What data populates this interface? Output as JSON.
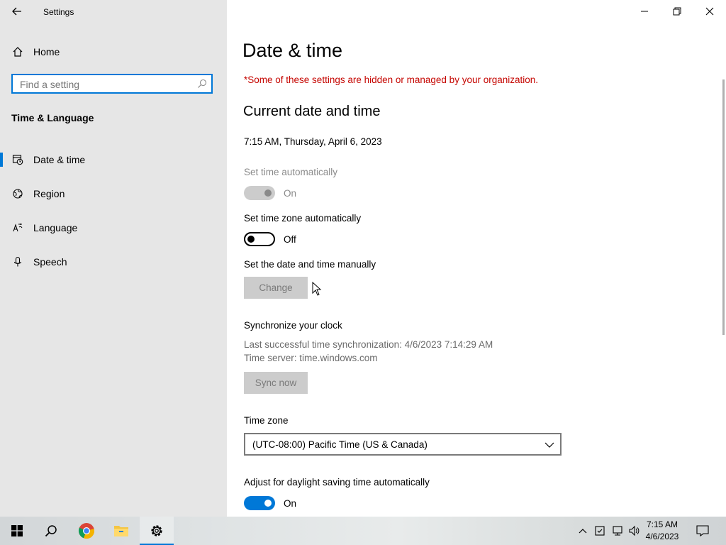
{
  "window": {
    "title": "Settings"
  },
  "sidebar": {
    "home_label": "Home",
    "search_placeholder": "Find a setting",
    "section": "Time & Language",
    "items": [
      {
        "label": "Date & time",
        "icon": "date-time-icon",
        "selected": true
      },
      {
        "label": "Region",
        "icon": "globe-icon",
        "selected": false
      },
      {
        "label": "Language",
        "icon": "language-icon",
        "selected": false
      },
      {
        "label": "Speech",
        "icon": "microphone-icon",
        "selected": false
      }
    ]
  },
  "main": {
    "title": "Date & time",
    "managed_notice": "*Some of these settings are hidden or managed by your organization.",
    "current_heading": "Current date and time",
    "current_value": "7:15 AM, Thursday, April 6, 2023",
    "set_time_auto": {
      "label": "Set time automatically",
      "state": "On",
      "on": true,
      "disabled": true
    },
    "set_tz_auto": {
      "label": "Set time zone automatically",
      "state": "Off",
      "on": false
    },
    "manual": {
      "label": "Set the date and time manually",
      "button": "Change"
    },
    "sync": {
      "heading": "Synchronize your clock",
      "last_sync": "Last successful time synchronization: 4/6/2023 7:14:29 AM",
      "server": "Time server: time.windows.com",
      "button": "Sync now"
    },
    "timezone": {
      "label": "Time zone",
      "value": "(UTC-08:00) Pacific Time (US & Canada)"
    },
    "dst": {
      "label": "Adjust for daylight saving time automatically",
      "state": "On",
      "on": true
    }
  },
  "taskbar": {
    "time": "7:15 AM",
    "date": "4/6/2023",
    "apps": [
      "windows-start-icon",
      "search-icon",
      "chrome-icon",
      "file-explorer-icon",
      "settings-icon"
    ]
  },
  "colors": {
    "accent": "#0078d7",
    "warning": "#c50500",
    "sidebar_bg": "#e6e6e6"
  }
}
